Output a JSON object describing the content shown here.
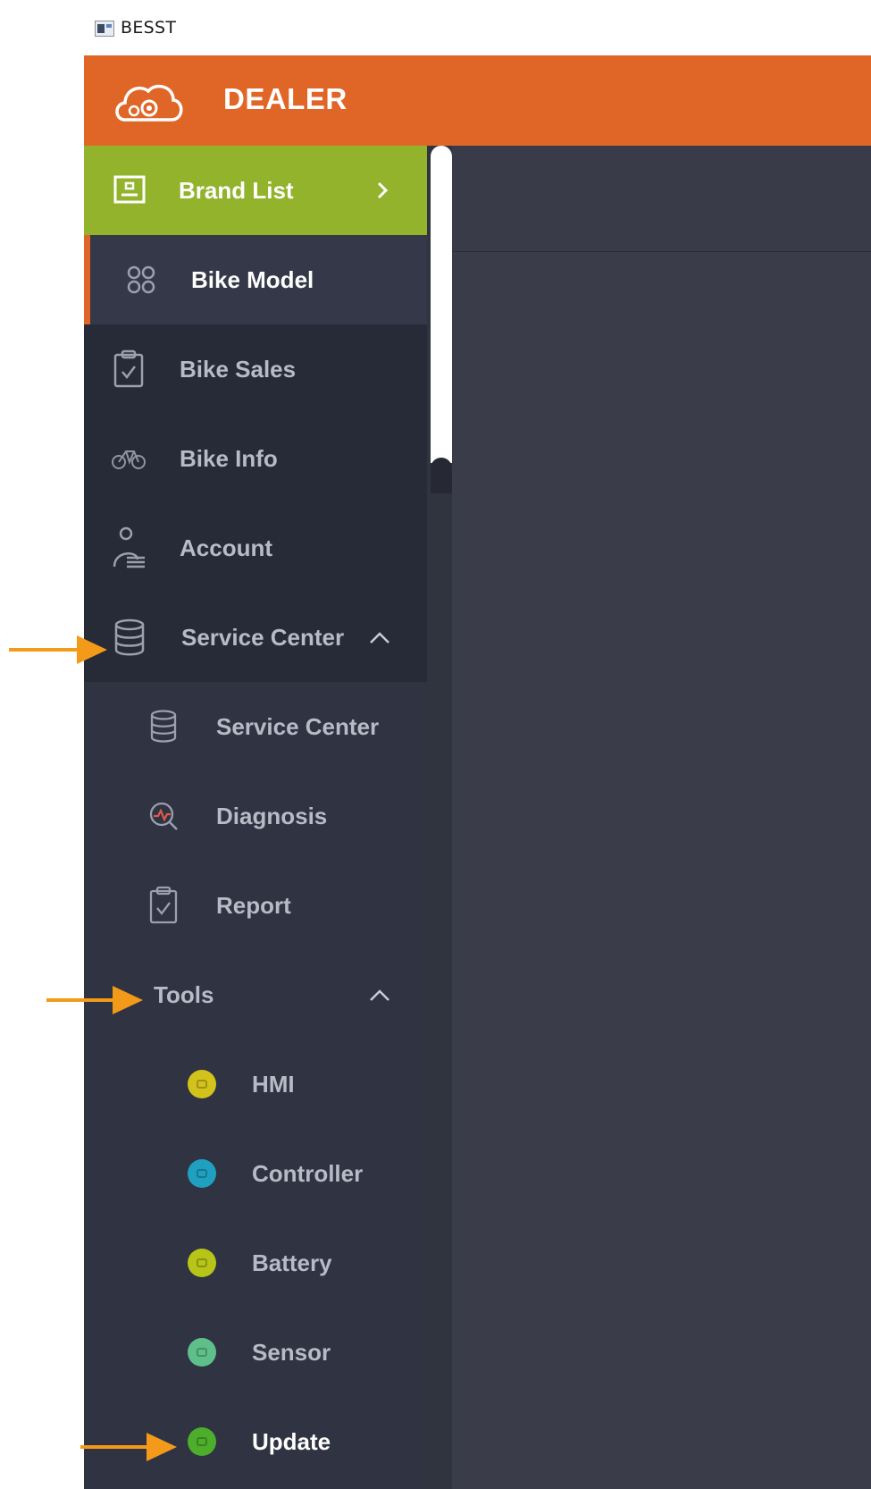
{
  "window": {
    "title": "BESST"
  },
  "header": {
    "brand": "DEALER"
  },
  "sidebar": {
    "brand_list": "Brand List",
    "items": [
      {
        "label": "Bike Model"
      },
      {
        "label": "Bike Sales"
      },
      {
        "label": "Bike Info"
      },
      {
        "label": "Account"
      },
      {
        "label": "Service Center"
      }
    ],
    "service_center_sub": [
      {
        "label": "Service Center"
      },
      {
        "label": "Diagnosis"
      },
      {
        "label": "Report"
      }
    ],
    "tools": {
      "label": "Tools",
      "items": [
        {
          "label": "HMI",
          "color": "#d4c21c"
        },
        {
          "label": "Controller",
          "color": "#1fa0c0"
        },
        {
          "label": "Battery",
          "color": "#b7c418"
        },
        {
          "label": "Sensor",
          "color": "#5fbf8b"
        },
        {
          "label": "Update",
          "color": "#4cae2a"
        }
      ]
    }
  },
  "colors": {
    "header": "#e06628",
    "brand_list": "#93b32d",
    "sidebar": "#2f3342",
    "arrow": "#f39a1a"
  }
}
